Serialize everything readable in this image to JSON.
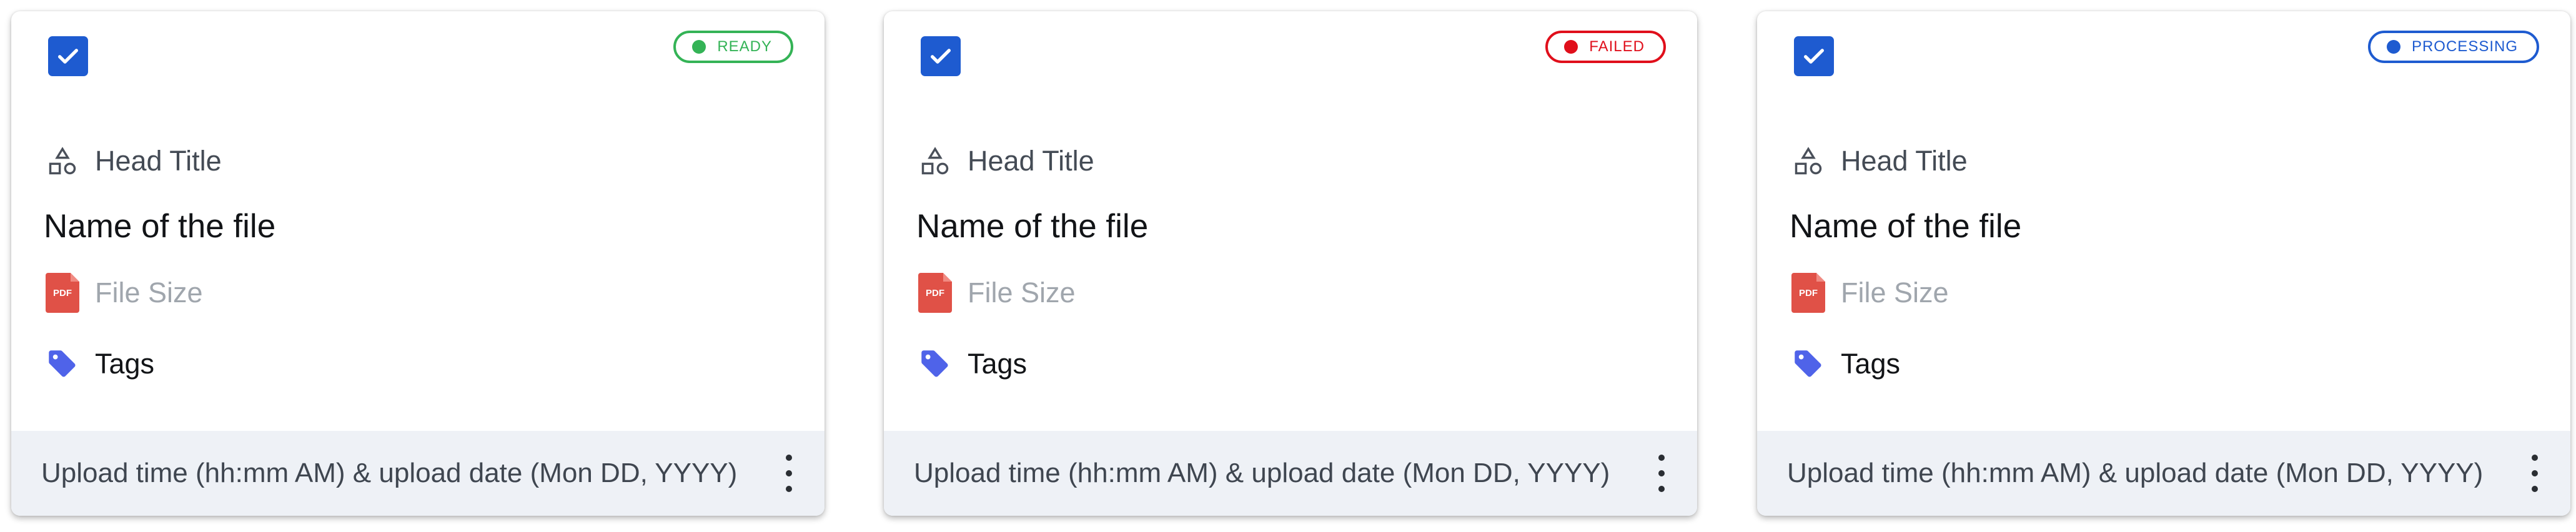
{
  "cards": [
    {
      "status": "READY",
      "status_color": "#34b356",
      "head_title": "Head Title",
      "file_name": "Name of the file",
      "file_size": "File Size",
      "tags": "Tags",
      "file_type": "PDF",
      "footer_text": "Upload time (hh:mm AM) & upload date (Mon DD, YYYY)",
      "checked": true
    },
    {
      "status": "FAILED",
      "status_color": "#e00f1b",
      "head_title": "Head Title",
      "file_name": "Name of the file",
      "file_size": "File Size",
      "tags": "Tags",
      "file_type": "PDF",
      "footer_text": "Upload time (hh:mm AM) & upload date (Mon DD, YYYY)",
      "checked": true
    },
    {
      "status": "PROCESSING",
      "status_color": "#1e5bd0",
      "head_title": "Head Title",
      "file_name": "Name of the file",
      "file_size": "File Size",
      "tags": "Tags",
      "file_type": "PDF",
      "footer_text": "Upload time (hh:mm AM) & upload date (Mon DD, YYYY)",
      "checked": true
    }
  ],
  "colors": {
    "checkbox": "#1e5bd0",
    "tag_icon": "#4f63e9",
    "pdf_icon": "#e05147",
    "footer_bg": "#eef1f6"
  },
  "icons": {
    "checkbox": "check-icon",
    "head": "shapes-icon",
    "file": "pdf-file-icon",
    "tags": "tag-icon",
    "menu": "more-vertical-icon"
  }
}
